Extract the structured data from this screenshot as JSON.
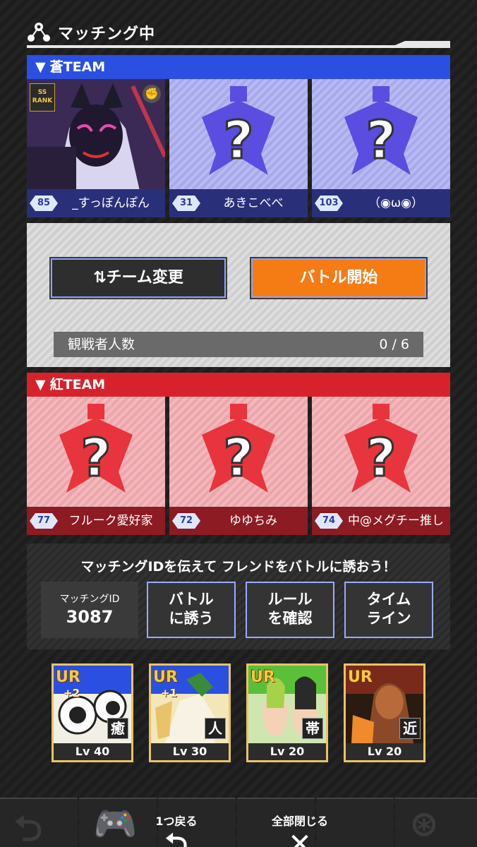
{
  "header": {
    "title": "マッチング中"
  },
  "blue_team": {
    "label": "蒼TEAM",
    "players": [
      {
        "level": "85",
        "name": "_すっぽんぽん",
        "rank": "SS RANK"
      },
      {
        "level": "31",
        "name": "あきこべべ"
      },
      {
        "level": "103",
        "name": "（◉ω◉）"
      }
    ]
  },
  "controls": {
    "change_team_label": "⇅チーム変更",
    "start_battle_label": "バトル開始",
    "spectator_label": "観戦者人数",
    "spectator_count": "0 / 6"
  },
  "red_team": {
    "label": "紅TEAM",
    "players": [
      {
        "level": "77",
        "name": "フルーク愛好家"
      },
      {
        "level": "72",
        "name": "ゆゆちみ"
      },
      {
        "level": "74",
        "name": "中@メグチー推し"
      }
    ]
  },
  "invite": {
    "message": "マッチングIDを伝えて フレンドをバトルに誘おう！",
    "match_id_label": "マッチングID",
    "match_id_value": "3087",
    "buttons": [
      {
        "line1": "バトル",
        "line2": "に誘う"
      },
      {
        "line1": "ルール",
        "line2": "を確認"
      },
      {
        "line1": "タイム",
        "line2": "ライン"
      }
    ]
  },
  "cards": [
    {
      "rarity": "UR",
      "plus": "+2",
      "role": "癒",
      "level": "Lv 40"
    },
    {
      "rarity": "UR",
      "plus": "+1",
      "role": "人",
      "level": "Lv 30"
    },
    {
      "rarity": "UR",
      "plus": "",
      "role": "帯",
      "level": "Lv 20"
    },
    {
      "rarity": "UR",
      "plus": "",
      "role": "近",
      "level": "Lv 20"
    }
  ],
  "bottom_nav": {
    "back_label": "1つ戻る",
    "close_all_label": "全部閉じる"
  },
  "colors": {
    "blue_team": "#2b4fe0",
    "red_team": "#d7222c",
    "start_button": "#f57b15",
    "card_border": "#e9c36a"
  }
}
